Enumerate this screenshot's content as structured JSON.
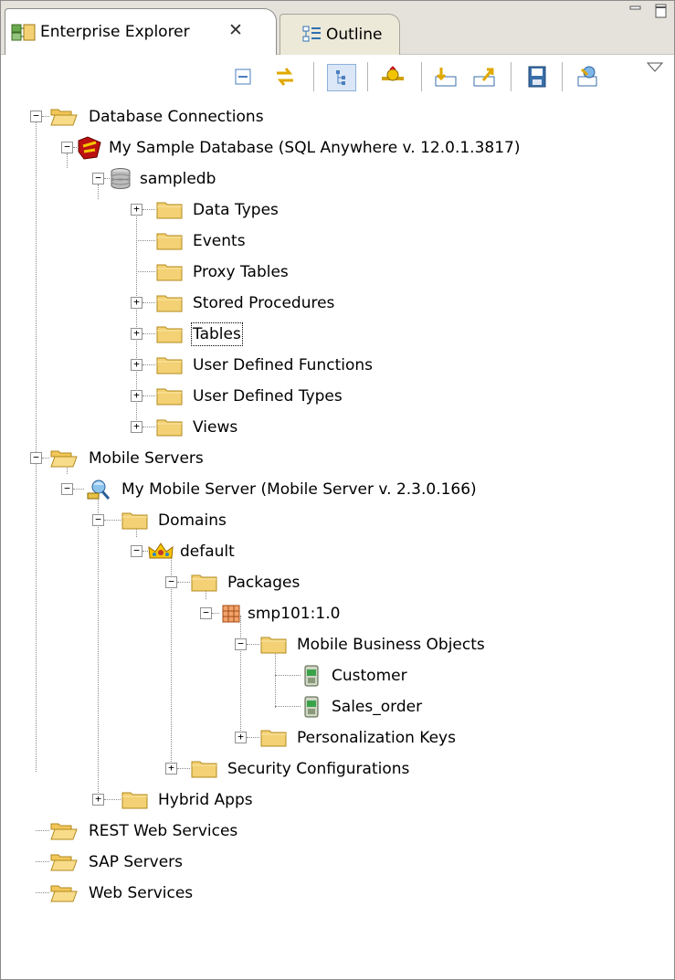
{
  "tabs": {
    "active_label": "Enterprise Explorer",
    "close_glyph": "✕",
    "inactive_label": "Outline"
  },
  "window_controls": {
    "minimize_glyph": "▭",
    "maximize_glyph": "▢"
  },
  "toolbar": {
    "icons": [
      "collapse-all-icon",
      "link-with-editor-icon",
      "show-tree-icon",
      "connect-icon",
      "import-icon",
      "export-icon",
      "save-icon",
      "deploy-icon",
      "view-menu-icon"
    ]
  },
  "colors": {
    "folder": "#f3d174",
    "folder_open": "#f2c75a",
    "tree_line": "#8a8a8a",
    "tab_bar": "#e4e2da"
  },
  "tree": {
    "database_connections": "Database Connections",
    "my_sample_database": "My Sample Database (SQL Anywhere v. 12.0.1.3817)",
    "sampledb": "sampledb",
    "data_types": "Data Types",
    "events": "Events",
    "proxy_tables": "Proxy Tables",
    "stored_procedures": "Stored Procedures",
    "tables": "Tables",
    "user_defined_functions": "User Defined Functions",
    "user_defined_types": "User Defined Types",
    "views": "Views",
    "mobile_servers": "Mobile Servers",
    "my_mobile_server": "My Mobile Server (Mobile Server v. 2.3.0.166)",
    "domains": "Domains",
    "default": "default",
    "packages": "Packages",
    "smp101": "smp101:1.0",
    "mobile_business_objects": "Mobile Business Objects",
    "customer": "Customer",
    "sales_order": "Sales_order",
    "personalization_keys": "Personalization Keys",
    "security_configurations": "Security Configurations",
    "hybrid_apps": "Hybrid Apps",
    "rest_web_services": "REST Web Services",
    "sap_servers": "SAP Servers",
    "web_services": "Web Services",
    "expand_glyph": "+",
    "collapse_glyph": "−"
  }
}
